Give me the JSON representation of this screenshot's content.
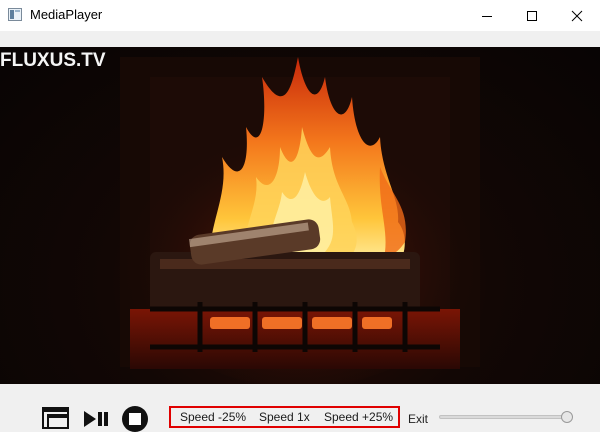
{
  "window": {
    "title": "MediaPlayer",
    "controls": [
      "minimize-icon",
      "maximize-icon",
      "close-icon"
    ]
  },
  "video": {
    "watermark": "FLUXUS.TV",
    "scene": "fireplace"
  },
  "controls": {
    "icons": [
      "fullscreen-icon",
      "play-pause-icon",
      "stop-icon"
    ],
    "speed_buttons": {
      "slower": "Speed -25%",
      "normal": "Speed 1x",
      "faster": "Speed +25%"
    },
    "exit_label": "Exit",
    "slider_value": 0.95
  },
  "colors": {
    "highlight_border": "#e00000",
    "chrome_background": "#f0f0f0",
    "flame_core": "#ffe07a",
    "flame_outer": "#e8480e"
  }
}
